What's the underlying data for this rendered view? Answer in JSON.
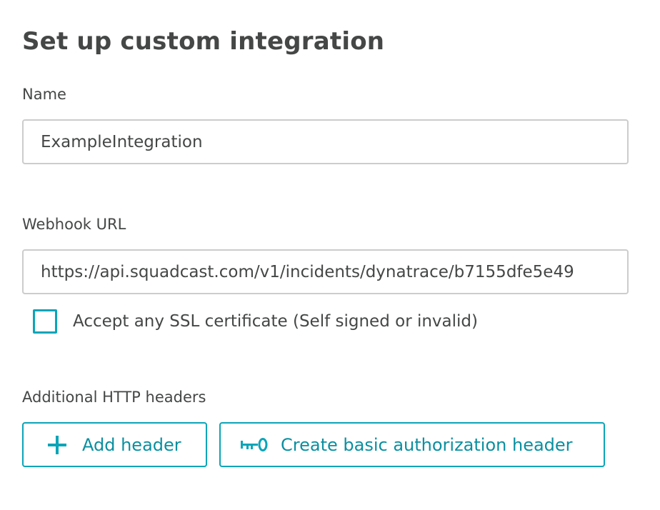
{
  "page": {
    "title": "Set up custom integration"
  },
  "form": {
    "name_label": "Name",
    "name_value": "ExampleIntegration",
    "webhook_label": "Webhook URL",
    "webhook_value": "https://api.squadcast.com/v1/incidents/dynatrace/b7155dfe5e49",
    "ssl_checkbox_label": "Accept any SSL certificate (Self signed or invalid)",
    "ssl_checked": false,
    "headers_label": "Additional HTTP headers"
  },
  "buttons": {
    "add_header_label": "Add header",
    "add_header_icon": "plus-icon",
    "basic_auth_label": "Create basic authorization header",
    "basic_auth_icon": "key-icon"
  },
  "colors": {
    "accent": "#0aa5b8",
    "accent_text": "#0a8fa0",
    "text": "#454646",
    "border": "#cccccc"
  }
}
